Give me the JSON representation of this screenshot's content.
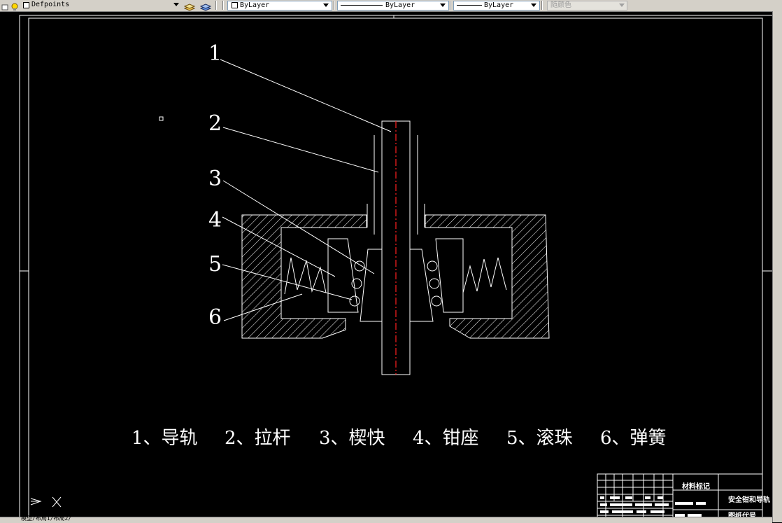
{
  "toolbar": {
    "layer_name": "Defpoints",
    "color_value": "ByLayer",
    "linetype_value": "ByLayer",
    "lineweight_value": "ByLayer",
    "plotstyle_value": "随颜色"
  },
  "drawing": {
    "callouts": [
      "1",
      "2",
      "3",
      "4",
      "5",
      "6"
    ],
    "legend": [
      "1、导轨",
      "2、拉杆",
      "3、楔快",
      "4、钳座",
      "5、滚珠",
      "6、弹簧"
    ],
    "title_block": {
      "material_mark": "材料标记",
      "drawing_name": "安全钳和导轨",
      "drawing_code": "图纸代号"
    }
  },
  "commandline": {
    "text": "模型/布局1/布局2/"
  },
  "colors": {
    "background": "#000000",
    "lines": "#ffffff",
    "centerline": "#ff0000",
    "ui": "#d4d0c8"
  }
}
